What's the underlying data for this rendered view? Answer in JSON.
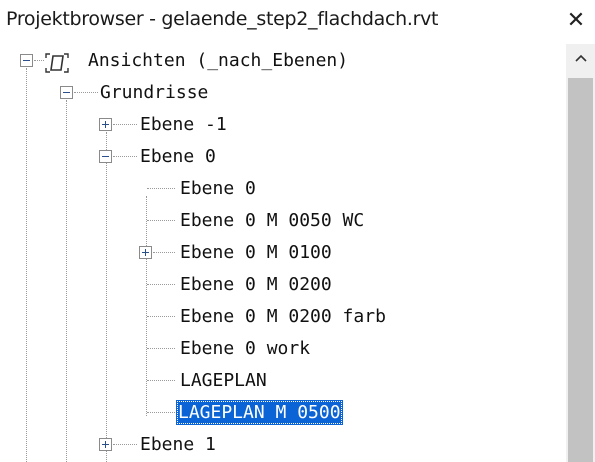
{
  "window": {
    "title": "Projektbrowser - gelaende_step2_flachdach.rvt",
    "close_glyph": "✕"
  },
  "tree": {
    "root": {
      "label": "Ansichten (_nach_Ebenen)",
      "icon": "view-icon",
      "expanded": true
    },
    "grundrisse": {
      "label": "Grundrisse",
      "expanded": true
    },
    "ebene_minus1": {
      "label": "Ebene -1",
      "expanded": false
    },
    "ebene0": {
      "label": "Ebene 0",
      "expanded": true
    },
    "children": [
      {
        "label": "Ebene 0"
      },
      {
        "label": "Ebene 0 M 0050 WC"
      },
      {
        "label": "Ebene 0 M 0100",
        "has_children": true
      },
      {
        "label": "Ebene 0 M 0200"
      },
      {
        "label": "Ebene 0 M 0200 farb"
      },
      {
        "label": "Ebene 0 work"
      },
      {
        "label": "LAGEPLAN"
      },
      {
        "label": "LAGEPLAN M 0500",
        "selected": true
      }
    ],
    "ebene1": {
      "label": "Ebene 1",
      "expanded": false
    }
  },
  "colors": {
    "selection": "#0a64d6",
    "tree_lines": "#9a9a9a",
    "scrollbar_thumb": "#c2c2c2"
  }
}
